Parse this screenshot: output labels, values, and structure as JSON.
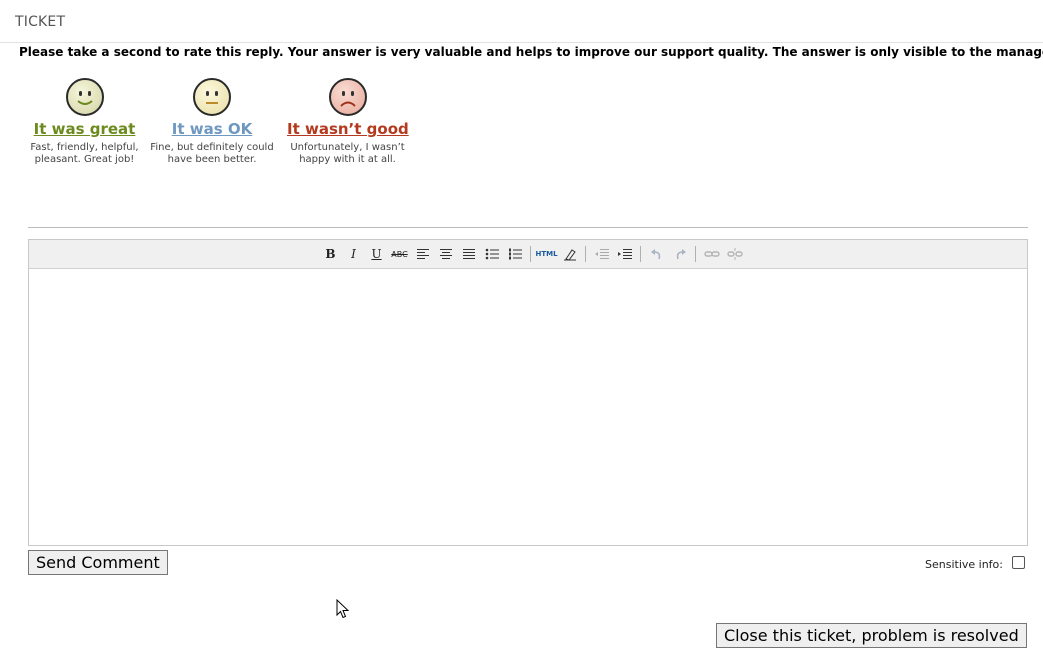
{
  "header": {
    "title": "TICKET"
  },
  "rating": {
    "intro": "Please take a second to rate this reply. Your answer is very valuable and helps to improve our support quality. The answer is only visible to the manager.",
    "options": [
      {
        "label": "It was great",
        "desc_line1": "Fast, friendly, helpful,",
        "desc_line2": "pleasant. Great job!",
        "icon": "smile-face-icon",
        "color": "#6c8a1e"
      },
      {
        "label": "It was OK",
        "desc_line1": "Fine, but definitely could",
        "desc_line2": "have been better.",
        "icon": "neutral-face-icon",
        "color": "#6f98c0"
      },
      {
        "label": "It wasn’t good",
        "desc_line1": "Unfortunately, I wasn’t",
        "desc_line2": "happy with it at all.",
        "icon": "sad-face-icon",
        "color": "#b33a1e"
      }
    ]
  },
  "editor": {
    "toolbar": {
      "bold": "B",
      "italic": "I",
      "underline": "U",
      "strike": "ABC",
      "html": "HTML",
      "icons": [
        "bold-icon",
        "italic-icon",
        "underline-icon",
        "strikethrough-icon",
        "align-left-icon",
        "align-center-icon",
        "align-justify-icon",
        "bullet-list-icon",
        "numbered-list-icon",
        "html-icon",
        "eraser-icon",
        "outdent-icon",
        "indent-icon",
        "undo-icon",
        "redo-icon",
        "link-icon",
        "unlink-icon"
      ]
    },
    "content": ""
  },
  "actions": {
    "send_label": "Send Comment",
    "sensitive_label": "Sensitive info:",
    "sensitive_checked": false,
    "close_label": "Close this ticket, problem is resolved"
  }
}
